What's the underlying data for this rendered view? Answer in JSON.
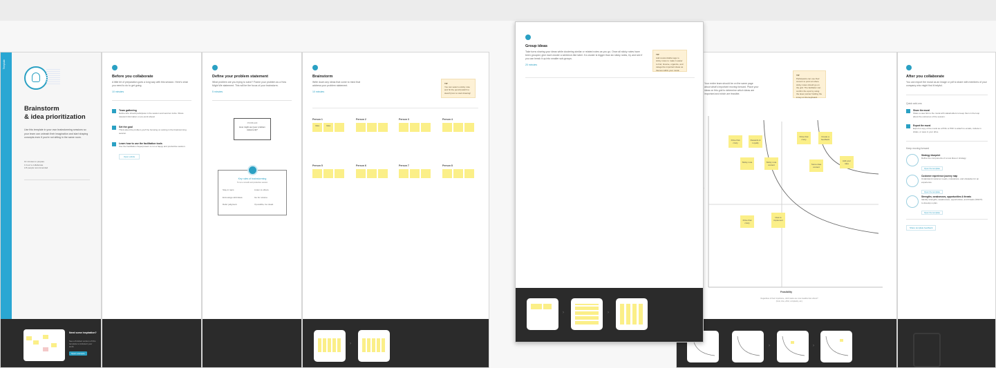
{
  "template": {
    "side_tab_label": "Template",
    "title": "Brainstorm & idea prioritization",
    "title_line1": "Brainstorm",
    "title_line2": "& idea prioritization",
    "description": "Use this template in your own brainstorming sessions so your team can unleash their imagination and start shaping concepts even if you're not sitting in the same room.",
    "stats": [
      "10 minutes to prepare",
      "1 hour to collaborate",
      "2-8 people recommended"
    ],
    "footer_heading": "Need some inspiration?",
    "footer_text": "See a finished version of this template to kickstart your work.",
    "footer_button": "Open example"
  },
  "panels": {
    "before": {
      "step": "1",
      "title": "Before you collaborate",
      "text": "A little bit of preparation goes a long way with this session. Here's what you need to do to get going.",
      "link": "10 minutes",
      "items": [
        {
          "title": "Team gathering",
          "text": "Define who should participate in the session and send an invite. Share relevant information or pre-work ahead."
        },
        {
          "title": "Set the goal",
          "text": "Think about the problem you'll be focusing on solving in the brainstorming session."
        },
        {
          "title": "Learn how to use the facilitation tools",
          "text": "Use the Facilitation Superpowers to run a happy and productive session."
        }
      ],
      "button": "Open article"
    },
    "define": {
      "step": "2",
      "title": "Define your problem statement",
      "text": "What problem are you trying to solve? Frame your problem as a How Might We statement. This will be the focus of your brainstorm.",
      "link": "5 minutes",
      "hmw_title": "PROBLEM",
      "hmw_text": "How might we [your problem statement]?",
      "tips_title": "Key rules of brainstorming",
      "tips_sub": "To run a smooth and productive session",
      "tips": [
        "Stay in topic.",
        "Encourage wild ideas.",
        "Defer judgment.",
        "Listen to others.",
        "Go for volume.",
        "If possible, be visual."
      ]
    },
    "brainstorm": {
      "step": "3",
      "title": "Brainstorm",
      "text": "Write down any ideas that come to mind that address your problem statement.",
      "link": "10 minutes",
      "note_title": "TIP",
      "note_text": "You can select a sticky note and hit the pencil [switch to sketch] icon to start drawing!",
      "people": [
        "Person 1",
        "Person 2",
        "Person 3",
        "Person 4",
        "Person 5",
        "Person 6",
        "Person 7",
        "Person 8"
      ],
      "sample_notes": [
        "Idea",
        "Idea",
        "Idea"
      ]
    },
    "group": {
      "step": "4",
      "title": "Group ideas",
      "text": "Take turns sharing your ideas while clustering similar or related notes as you go. Once all sticky notes have been grouped, give each cluster a sentence-like label. If a cluster is bigger than six sticky notes, try and see if you can break it up into smaller sub-groups.",
      "link": "20 minutes",
      "note_title": "TIP",
      "note_text": "Add customizable tags to sticky notes to make it easier to find, browse, organize, and categorize important ideas as themes within your mural."
    },
    "prioritize": {
      "text": "Your entire team should be on the same page about what's important moving forward. Place your ideas on this grid to determine which ideas are important and which are feasible.",
      "note_title": "TIP",
      "note_text": "Participants can use their cursors to point at where sticky notes should go on the grid. The facilitator can confirm the spot by using the laser pointer holding the H key on the keyboard.",
      "stickies": [
        "Drive that crazy",
        "Rewards & Loyalty",
        "Sticky note",
        "Sticky note content",
        "Drive that crazy",
        "Create a feedback",
        "Some idea content",
        "Add your idea",
        "Drive that crazy",
        "Idea to implement"
      ],
      "x_label": "Feasibility",
      "x_sub": "Regardless of their importance, which tasks are more feasible than others? (Cost, time, effort, complexity, etc.)",
      "y_label": "Importance"
    },
    "after": {
      "title": "After you collaborate",
      "text": "You can export the mural as an image or pdf to share with members of your company who might find it helpful.",
      "quick_title": "Quick add-ons",
      "quick": [
        {
          "title": "Share the mural",
          "text": "Share a view link to the mural with stakeholders to keep them in the loop about the outcomes of the session."
        },
        {
          "title": "Export the mural",
          "text": "Export a copy of the mural as a PNG or PDF to attach to emails, include in slides, or save in your drive."
        }
      ],
      "keep_title": "Keep moving forward",
      "keep": [
        {
          "title": "Strategy blueprint",
          "text": "Define the components of a new idea or strategy.",
          "button": "Open the template"
        },
        {
          "title": "Customer experience journey map",
          "text": "Understand customer needs, motivations, and obstacles for an experience.",
          "button": "Open the template"
        },
        {
          "title": "Strengths, weaknesses, opportunities & threats",
          "text": "Identify strengths, weaknesses, opportunities, and threats (SWOT) to develop a plan.",
          "button": "Open the template"
        }
      ],
      "share_button": "Share template feedback"
    }
  },
  "colors": {
    "accent": "#2aa0c3",
    "sticky": "#fbef88",
    "footer": "#2b2b2b",
    "note": "#fdf1d6"
  }
}
